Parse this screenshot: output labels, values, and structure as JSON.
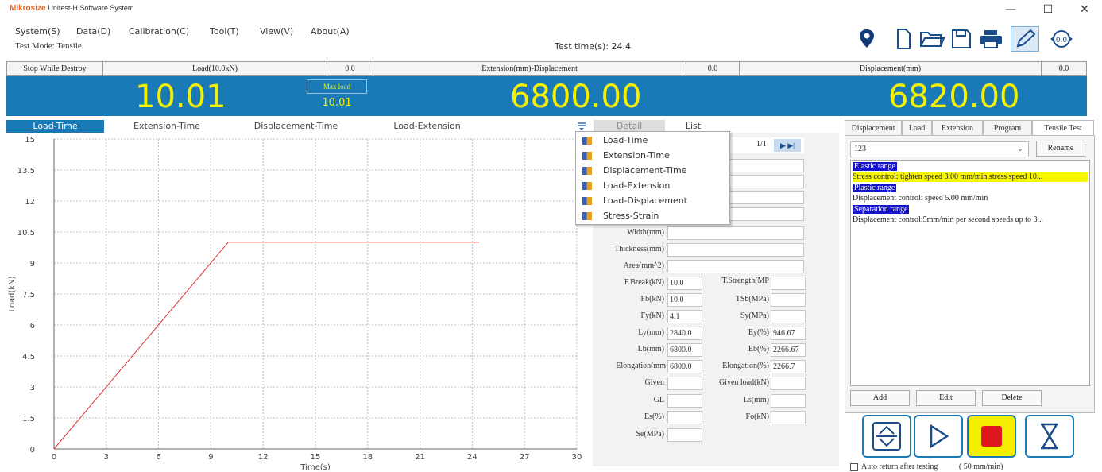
{
  "app": {
    "brand": "Mikrosize",
    "title": "Unitest-H Software System"
  },
  "window_controls": {
    "minimize": "—",
    "maximize": "☐",
    "close": "✕"
  },
  "menu": [
    {
      "label": "System(S)"
    },
    {
      "label": "Data(D)"
    },
    {
      "label": "Calibration(C)"
    },
    {
      "label": "Tool(T)"
    },
    {
      "label": "View(V)"
    },
    {
      "label": "About(A)"
    }
  ],
  "status": {
    "test_mode": "Test Mode:   Tensile",
    "test_time": "Test time(s):  24.4"
  },
  "toolbar_icons": [
    "location-icon",
    "new-file-icon",
    "open-folder-icon",
    "save-icon",
    "print-icon",
    "edit-pencil-icon",
    "zero-icon"
  ],
  "readout": {
    "stop_while_destroy": "Stop While Destroy",
    "load_label": "Load(10.0kN)",
    "load_zero": "0.0",
    "ext_label": "Extension(mm)-Displacement",
    "ext_zero": "0.0",
    "disp_label": "Displacement(mm)",
    "disp_zero": "0.0",
    "load_value": "10.01",
    "max_load_label": "Max load",
    "max_load_value": "10.01",
    "ext_value": "6800.00",
    "disp_value": "6820.00"
  },
  "chart_tabs": [
    {
      "label": "Load-Time"
    },
    {
      "label": "Extension-Time"
    },
    {
      "label": "Displacement-Time"
    },
    {
      "label": "Load-Extension"
    }
  ],
  "detail_tabs": {
    "detail": "Detail",
    "list": "List"
  },
  "pager": {
    "page": "1/1"
  },
  "dropdown": [
    {
      "label": "Load-Time"
    },
    {
      "label": "Extension-Time"
    },
    {
      "label": "Displacement-Time"
    },
    {
      "label": "Load-Extension"
    },
    {
      "label": "Load-Displacement"
    },
    {
      "label": "Stress-Strain"
    }
  ],
  "chart_data": {
    "type": "line",
    "xlabel": "Time(s)",
    "ylabel": "Load(kN)",
    "xlim": [
      0,
      30
    ],
    "ylim": [
      0,
      15
    ],
    "xticks": [
      0,
      3,
      6,
      9,
      12,
      15,
      18,
      21,
      24,
      27,
      30
    ],
    "yticks": [
      0,
      1.5,
      3,
      4.5,
      6,
      7.5,
      9,
      10.5,
      12,
      13.5,
      15
    ],
    "grid": true,
    "series": [
      {
        "color": "#e03030",
        "x": [
          0,
          10,
          24.4
        ],
        "y": [
          0,
          10.01,
          10.01
        ]
      }
    ]
  },
  "detail_fields": {
    "width_label": "Width(mm)",
    "thickness_label": "Thickness(mm)",
    "area_label": "Area(mm^2)",
    "fbreak_label": "F.Break(kN)",
    "fbreak_value": "10.0",
    "tstrength_label": "T.Strength(MP",
    "fb_label": "Fb(kN)",
    "fb_value": "10.0",
    "tsb_label": "TSb(MPa)",
    "fy_label": "Fy(kN)",
    "fy_value": "4.1",
    "sy_label": "Sy(MPa)",
    "ly_label": "Ly(mm)",
    "ly_value": "2840.0",
    "ey_label": "Ey(%)",
    "ey_value": "946.67",
    "lb_label": "Lb(mm)",
    "lb_value": "6800.0",
    "eb_label": "Eb(%)",
    "eb_value": "2266.67",
    "elong_mm_label": "Elongation(mm",
    "elong_mm_value": "6800.0",
    "elong_pct_label": "Elongation(%)",
    "elong_pct_value": "2266.7",
    "given_label": "Given",
    "given_load_label": "Given load(kN)",
    "gl_label": "GL",
    "ls_label": "Ls(mm)",
    "es_label": "Es(%)",
    "fo_label": "Fo(kN)",
    "se_label": "Se(MPa)"
  },
  "right_tabs": [
    {
      "label": "Displacement"
    },
    {
      "label": "Load"
    },
    {
      "label": "Extension"
    },
    {
      "label": "Program"
    },
    {
      "label": "Tensile Test"
    }
  ],
  "program": {
    "selected": "123",
    "rename": "Rename",
    "lines": [
      {
        "text": "Elastic range",
        "style": "blue"
      },
      {
        "text": "Stress control: tighten speed 3.00 mm/min,stress speed 10...",
        "style": "yellow"
      },
      {
        "text": "Plastic range",
        "style": "blue"
      },
      {
        "text": "Displacement control: speed 5.00 mm/min",
        "style": "plain"
      },
      {
        "text": "Separation range",
        "style": "blue"
      },
      {
        "text": "Displacement control:5mm/min per second speeds up to 3...",
        "style": "plain"
      }
    ],
    "add": "Add",
    "edit": "Edit",
    "delete": "Delete"
  },
  "controls": {
    "auto_return": "Auto return after testing",
    "speed": "( 50    mm/min)"
  }
}
